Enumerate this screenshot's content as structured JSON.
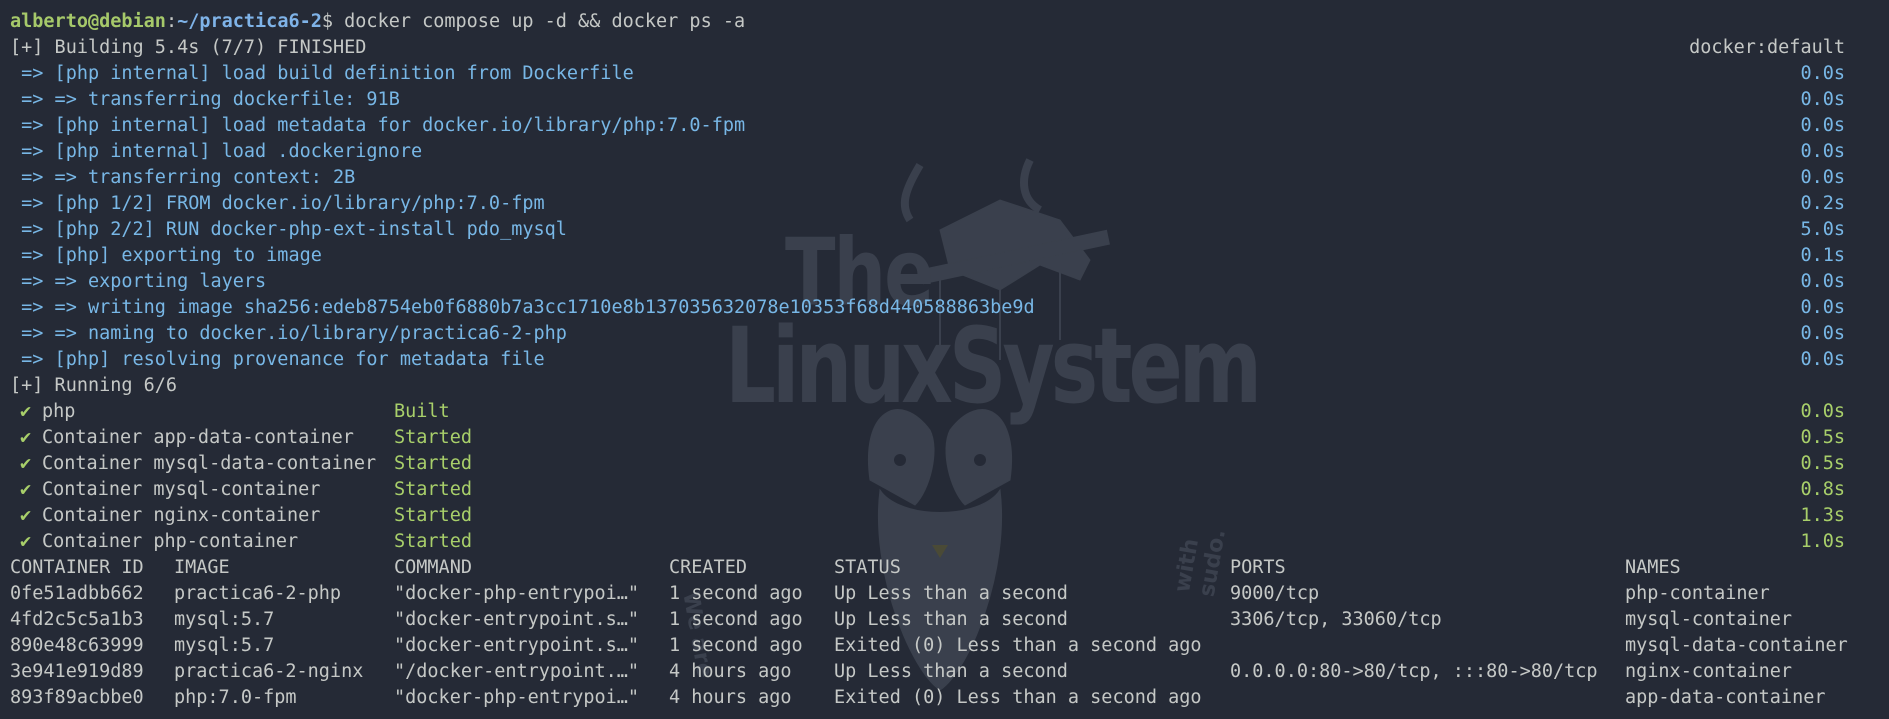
{
  "prompt": {
    "user_host": "alberto@debian",
    "sep": ":",
    "cwd": "~/practica6-2",
    "dollar": "$",
    "command": " docker compose up -d && docker ps -a"
  },
  "build_header": "[+] Building 5.4s (7/7) FINISHED",
  "build_context": "docker:default",
  "build_steps": [
    {
      "text": " => [php internal] load build definition from Dockerfile",
      "time": "0.0s"
    },
    {
      "text": " => => transferring dockerfile: 91B",
      "time": "0.0s"
    },
    {
      "text": " => [php internal] load metadata for docker.io/library/php:7.0-fpm",
      "time": "0.0s"
    },
    {
      "text": " => [php internal] load .dockerignore",
      "time": "0.0s"
    },
    {
      "text": " => => transferring context: 2B",
      "time": "0.0s"
    },
    {
      "text": " => [php 1/2] FROM docker.io/library/php:7.0-fpm",
      "time": "0.2s"
    },
    {
      "text": " => [php 2/2] RUN docker-php-ext-install pdo_mysql",
      "time": "5.0s"
    },
    {
      "text": " => [php] exporting to image",
      "time": "0.1s"
    },
    {
      "text": " => => exporting layers",
      "time": "0.0s"
    },
    {
      "text": " => => writing image sha256:edeb8754eb0f6880b7a3cc1710e8b137035632078e10353f68d440588863be9d",
      "time": "0.0s"
    },
    {
      "text": " => => naming to docker.io/library/practica6-2-php",
      "time": "0.0s"
    },
    {
      "text": " => [php] resolving provenance for metadata file",
      "time": "0.0s"
    }
  ],
  "running_header": "[+] Running 6/6",
  "running_items": [
    {
      "check": "✔",
      "name": "php",
      "status": "Built",
      "time": "0.0s"
    },
    {
      "check": "✔",
      "name": "Container app-data-container",
      "status": "Started",
      "time": "0.5s"
    },
    {
      "check": "✔",
      "name": "Container mysql-data-container",
      "status": "Started",
      "time": "0.5s"
    },
    {
      "check": "✔",
      "name": "Container mysql-container",
      "status": "Started",
      "time": "0.8s"
    },
    {
      "check": "✔",
      "name": "Container nginx-container",
      "status": "Started",
      "time": "1.3s"
    },
    {
      "check": "✔",
      "name": "Container php-container",
      "status": "Started",
      "time": "1.0s"
    }
  ],
  "ps_table": {
    "headers": [
      "CONTAINER ID",
      "IMAGE",
      "COMMAND",
      "CREATED",
      "STATUS",
      "PORTS",
      "NAMES"
    ],
    "rows": [
      [
        "0fe51adbb662",
        "practica6-2-php",
        "\"docker-php-entrypoi…\"",
        "1 second ago",
        "Up Less than a second",
        "9000/tcp",
        "php-container"
      ],
      [
        "4fd2c5c5a1b3",
        "mysql:5.7",
        "\"docker-entrypoint.s…\"",
        "1 second ago",
        "Up Less than a second",
        "3306/tcp, 33060/tcp",
        "mysql-container"
      ],
      [
        "890e48c63999",
        "mysql:5.7",
        "\"docker-entrypoint.s…\"",
        "1 second ago",
        "Exited (0) Less than a second ago",
        "",
        "mysql-data-container"
      ],
      [
        "3e941e919d89",
        "practica6-2-nginx",
        "\"/docker-entrypoint.…\"",
        "4 hours ago",
        "Up Less than a second",
        "0.0.0.0:80->80/tcp, :::80->80/tcp",
        "nginx-container"
      ],
      [
        "893f89acbbe0",
        "php:7.0-fpm",
        "\"docker-php-entrypoi…\"",
        "4 hours ago",
        "Exited (0) Less than a second ago",
        "",
        "app-data-container"
      ]
    ]
  },
  "watermark": {
    "line1": "The",
    "line2": "LinuxSystem",
    "side_left": "We are",
    "side_right": "with sudo."
  },
  "colors": {
    "background": "#252a36",
    "prompt_user": "#a6c96a",
    "prompt_path": "#7fb3e8",
    "build_text": "#78b7e6",
    "status_green": "#a8cf6a"
  }
}
